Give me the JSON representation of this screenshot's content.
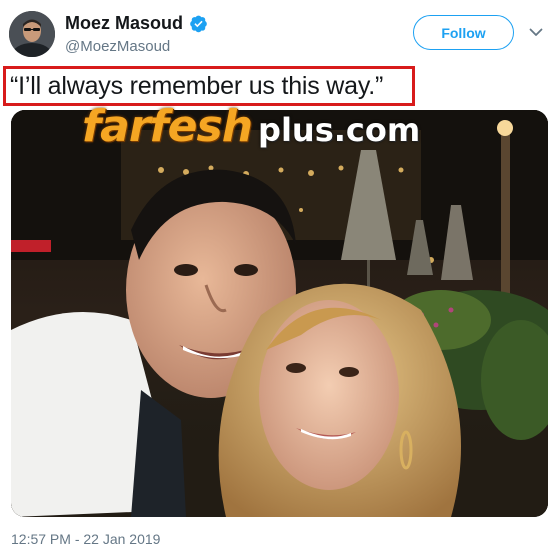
{
  "author": {
    "display_name": "Moez Masoud",
    "handle": "@MoezMasoud",
    "verified": true,
    "verified_color": "#1da1f2"
  },
  "actions": {
    "follow_label": "Follow",
    "more_icon": "chevron-down-icon"
  },
  "tweet": {
    "text": "“I’ll always remember us this way.”",
    "highlight_color": "#d81b1b",
    "timestamp": "12:57 PM - 22 Jan 2019"
  },
  "media": {
    "kind": "photo",
    "watermark": {
      "brand": "farfesh",
      "domain": "plus.com",
      "brand_color": "#f5a623"
    }
  },
  "colors": {
    "accent": "#1da1f2",
    "secondary_text": "#657786"
  }
}
